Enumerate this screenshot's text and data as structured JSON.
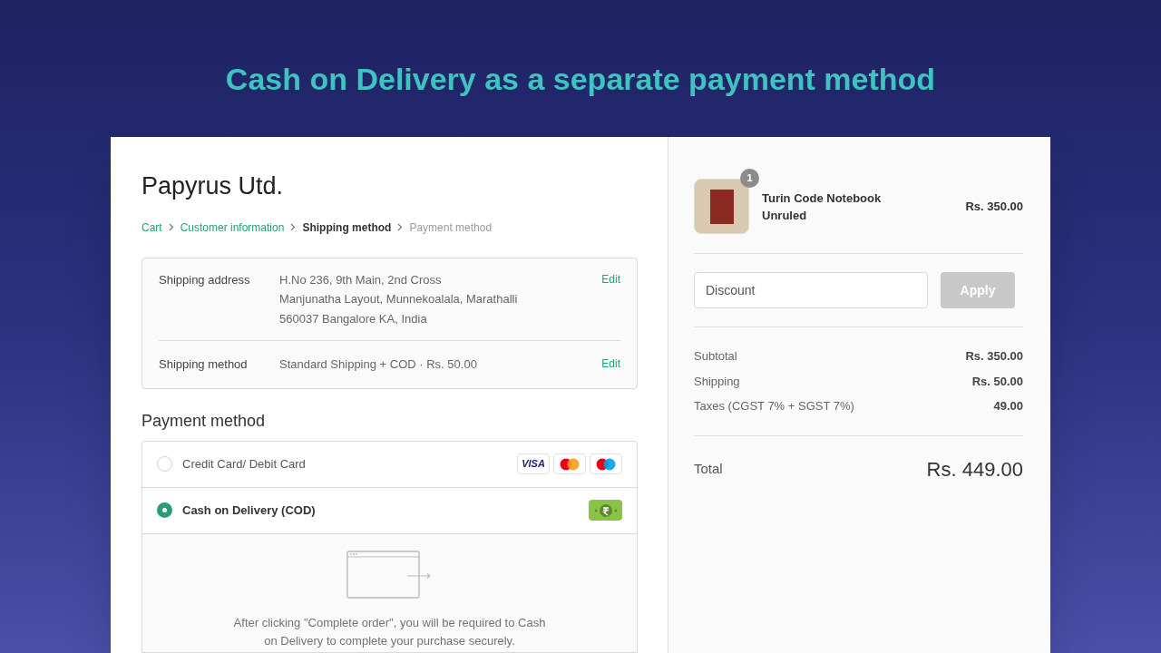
{
  "headline": "Cash on Delivery as a separate payment method",
  "store_name": "Papyrus Utd.",
  "breadcrumb": [
    {
      "label": "Cart",
      "kind": "done"
    },
    {
      "label": "Customer information",
      "kind": "done"
    },
    {
      "label": "Shipping method",
      "kind": "current"
    },
    {
      "label": "Payment method",
      "kind": "upcoming"
    }
  ],
  "review": [
    {
      "label": "Shipping address",
      "lines": [
        "H.No 236, 9th Main, 2nd Cross",
        "Manjunatha Layout, Munnekoalala, Marathalli",
        "560037 Bangalore KA, India"
      ],
      "action": "Edit"
    },
    {
      "label": "Shipping method",
      "lines": [
        "Standard Shipping + COD · Rs. 50.00"
      ],
      "action": "Edit"
    }
  ],
  "payment": {
    "title": "Payment method",
    "options": [
      {
        "label": "Credit Card/ Debit Card",
        "selected": false,
        "logos": [
          {
            "kind": "visa",
            "text": "VISA"
          },
          {
            "kind": "mastercard"
          },
          {
            "kind": "maestro"
          }
        ]
      },
      {
        "label": "Cash on Delivery (COD)",
        "selected": true,
        "logos": [
          {
            "kind": "cash"
          }
        ]
      }
    ],
    "note": "After clicking \"Complete order\", you will be required to Cash on Delivery to complete your purchase securely."
  },
  "summary": {
    "item": {
      "name": "Turin Code Notebook Unruled",
      "quantity": "1",
      "price": "Rs. 350.00"
    },
    "discount": {
      "placeholder": "Discount",
      "button": "Apply",
      "disabled": true
    },
    "lines": [
      {
        "label": "Subtotal",
        "value": "Rs. 350.00"
      },
      {
        "label": "Shipping",
        "value": "Rs. 50.00"
      },
      {
        "label": "Taxes (CGST 7% + SGST 7%)",
        "value": "49.00"
      }
    ],
    "total": {
      "label": "Total",
      "value": "Rs. 449.00"
    }
  }
}
